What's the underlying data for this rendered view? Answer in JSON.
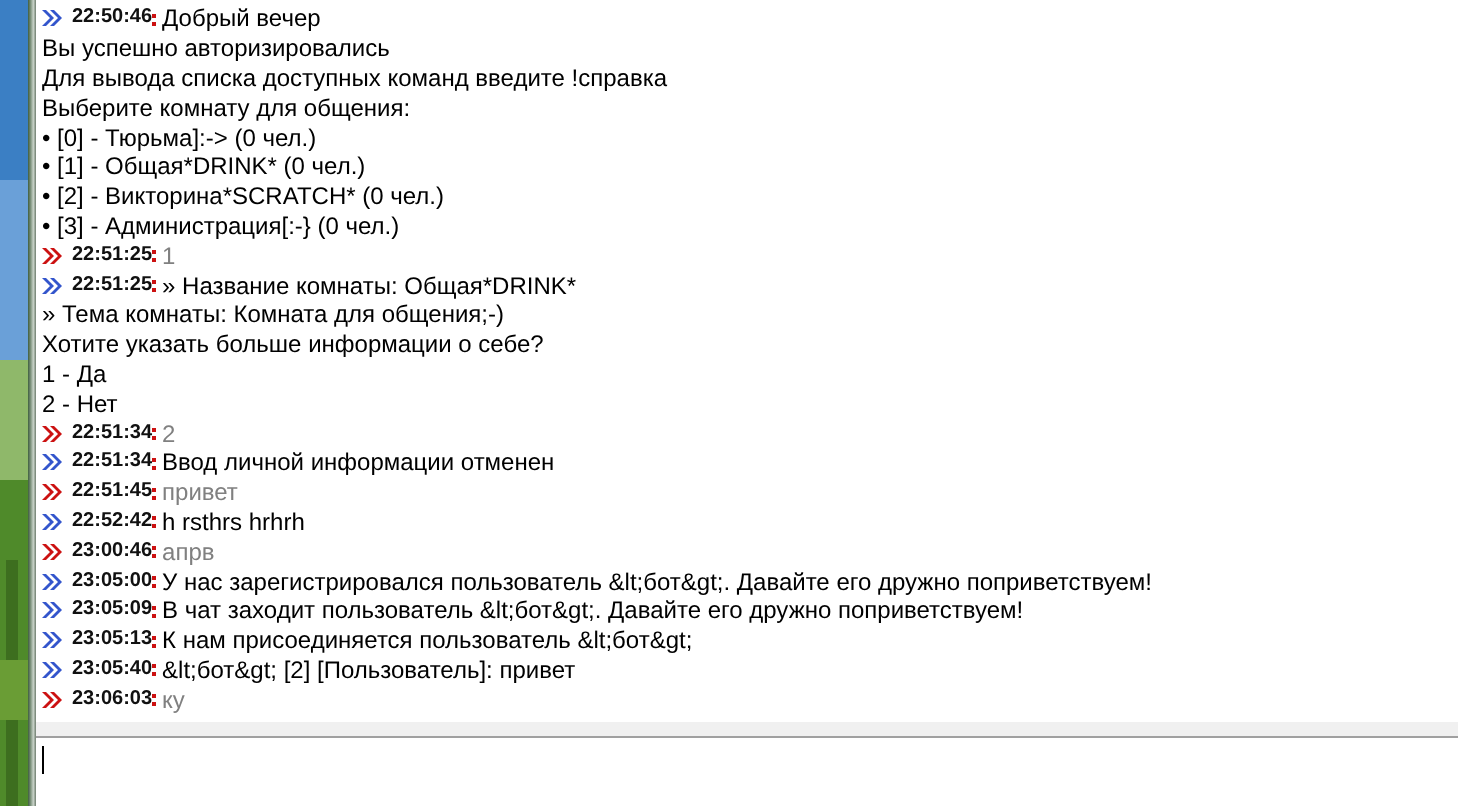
{
  "messages": [
    {
      "kind": "incoming",
      "time": "22:50:46",
      "text": "Добрый вечер"
    },
    {
      "kind": "plain",
      "text": "Вы успешно авторизировались"
    },
    {
      "kind": "plain",
      "text": "Для вывода списка доступных команд введите !справка"
    },
    {
      "kind": "plain",
      "text": "Выберите комнату для общения:"
    },
    {
      "kind": "plain",
      "text": "• [0] - Тюрьма]:-> (0 чел.)"
    },
    {
      "kind": "plain",
      "text": "• [1] - Общая*DRINK* (0 чел.)"
    },
    {
      "kind": "plain",
      "text": "• [2] - Викторина*SCRATCH* (0 чел.)"
    },
    {
      "kind": "plain",
      "text": "• [3] - Администрация[:-} (0 чел.)"
    },
    {
      "kind": "outgoing",
      "time": "22:51:25",
      "text": "1"
    },
    {
      "kind": "incoming",
      "time": "22:51:25",
      "text": "» Название комнаты: Общая*DRINK*"
    },
    {
      "kind": "plain",
      "text": "» Тема комнаты: Комната для общения;-)"
    },
    {
      "kind": "plain",
      "text": "Хотите указать больше информации о себе?"
    },
    {
      "kind": "plain",
      "text": "1 - Да"
    },
    {
      "kind": "plain",
      "text": "2 - Нет"
    },
    {
      "kind": "outgoing",
      "time": "22:51:34",
      "text": "2"
    },
    {
      "kind": "incoming",
      "time": "22:51:34",
      "text": "Ввод личной информации отменен"
    },
    {
      "kind": "outgoing",
      "time": "22:51:45",
      "text": "привет"
    },
    {
      "kind": "incoming",
      "time": "22:52:42",
      "text": "h rsthrs hrhrh"
    },
    {
      "kind": "outgoing",
      "time": "23:00:46",
      "text": "апрв"
    },
    {
      "kind": "incoming",
      "time": "23:05:00",
      "text": "У нас зарегистрировался пользователь &lt;бот&gt;. Давайте его дружно поприветствуем!"
    },
    {
      "kind": "incoming",
      "time": "23:05:09",
      "text": "В чат заходит пользователь &lt;бот&gt;. Давайте его дружно поприветствуем!"
    },
    {
      "kind": "incoming",
      "time": "23:05:13",
      "text": "К нам присоединяется пользователь &lt;бот&gt;"
    },
    {
      "kind": "incoming",
      "time": "23:05:40",
      "text": "&lt;бот&gt; [2] [Пользователь]: привет"
    },
    {
      "kind": "outgoing",
      "time": "23:06:03",
      "text": "ку"
    }
  ]
}
